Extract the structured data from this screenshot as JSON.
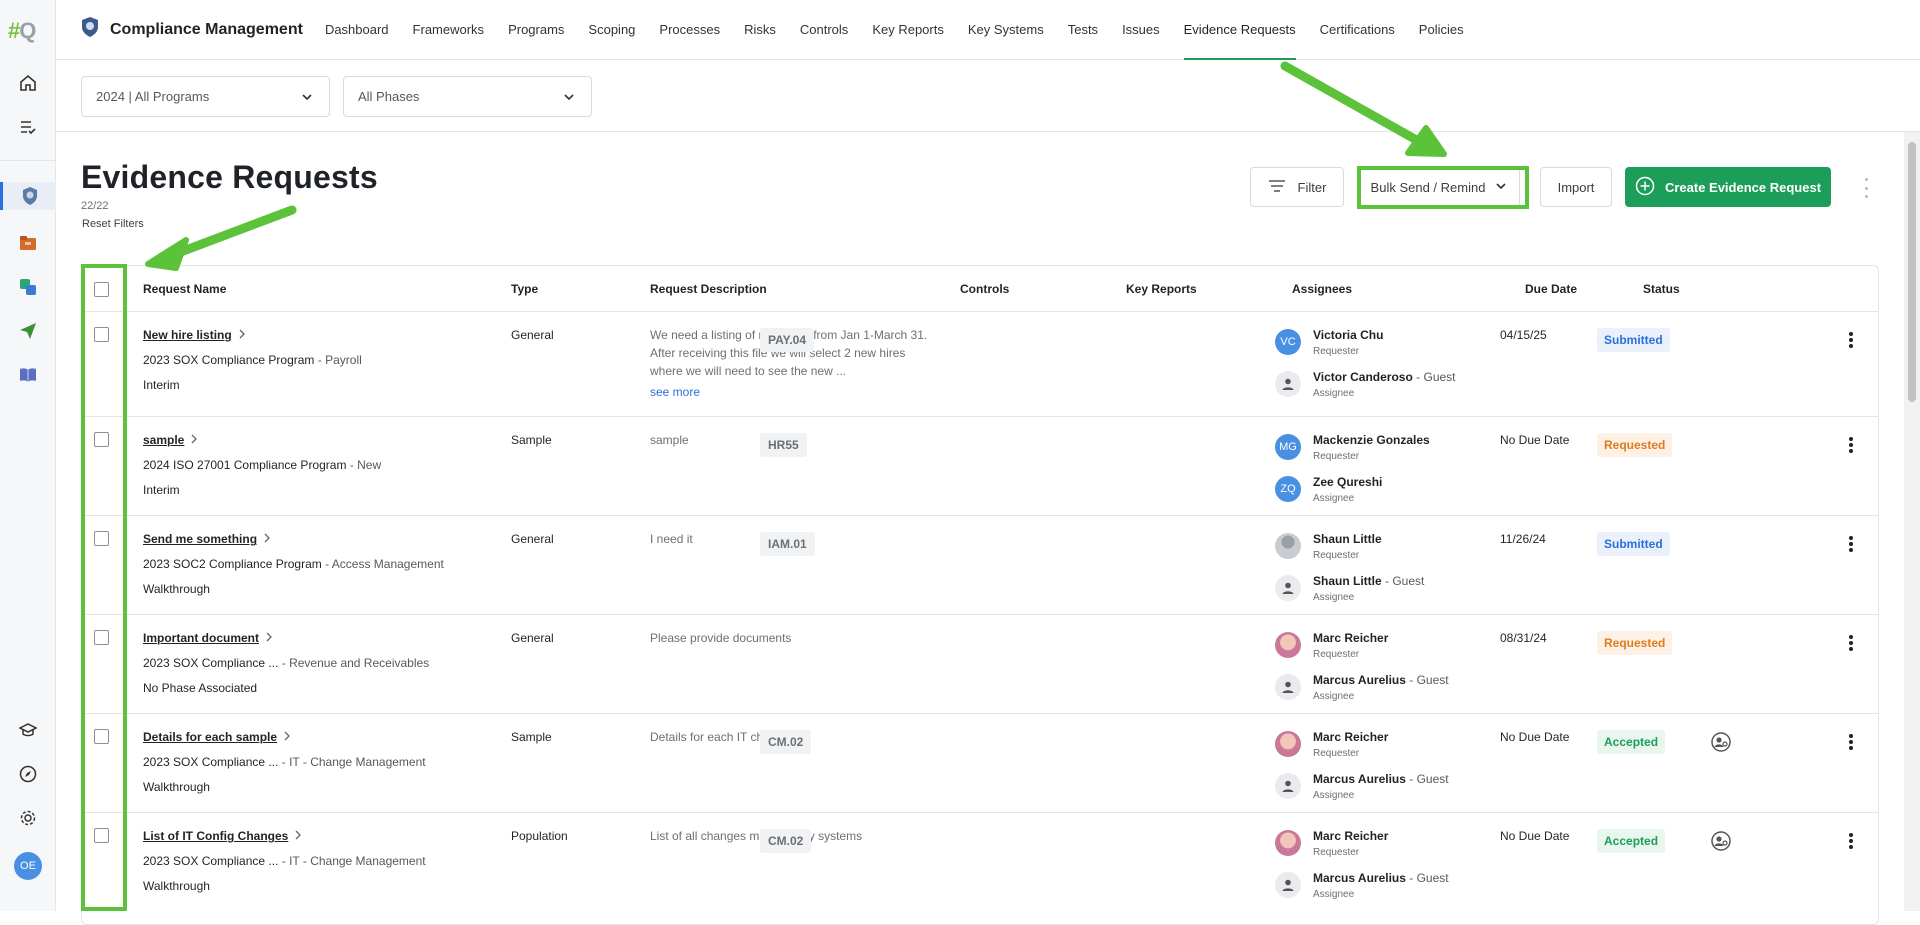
{
  "rail": {
    "logo_main": "#",
    "logo_suffix": "Q",
    "user_initials": "OE"
  },
  "app": {
    "title": "Compliance Management"
  },
  "nav": [
    "Dashboard",
    "Frameworks",
    "Programs",
    "Scoping",
    "Processes",
    "Risks",
    "Controls",
    "Key Reports",
    "Key Systems",
    "Tests",
    "Issues",
    "Evidence Requests",
    "Certifications",
    "Policies"
  ],
  "nav_active": "Evidence Requests",
  "filters": {
    "program": "2024 | All Programs",
    "phase": "All Phases"
  },
  "page": {
    "title": "Evidence Requests",
    "count": "22/22",
    "reset": "Reset Filters"
  },
  "actions": {
    "filter": "Filter",
    "bulk": "Bulk Send / Remind",
    "import": "Import",
    "create": "Create Evidence Request"
  },
  "columns": [
    "Request Name",
    "Type",
    "Request Description",
    "Controls",
    "Key Reports",
    "Assignees",
    "Due Date",
    "Status"
  ],
  "rows": [
    {
      "name": "New hire listing",
      "program": "2023 SOX Compliance Program",
      "process": "Payroll",
      "phase": "Interim",
      "type": "General",
      "desc": "We need a listing of new hires from Jan 1-March 31. After receiving this file we will select 2 new hires where we will need to see the new ...",
      "more": "see more",
      "control": "PAY.04",
      "req_initials": "VC",
      "requester": "Victoria Chu",
      "requester_role": "Requester",
      "assignee": "Victor Canderoso",
      "assignee_suffix": "Guest",
      "assignee_role": "Assignee",
      "due": "04/15/25",
      "status": "Submitted"
    },
    {
      "name": "sample",
      "program": "2024 ISO 27001 Compliance Program",
      "process": "New",
      "phase": "Interim",
      "type": "Sample",
      "desc": "sample",
      "control": "HR55",
      "req_initials": "MG",
      "requester": "Mackenzie Gonzales",
      "requester_role": "Requester",
      "asg_initials": "ZQ",
      "assignee": "Zee Qureshi",
      "assignee_role": "Assignee",
      "due": "No Due Date",
      "status": "Requested"
    },
    {
      "name": "Send me something",
      "program": "2023 SOC2 Compliance Program",
      "process": "Access Management",
      "phase": "Walkthrough",
      "type": "General",
      "desc": "I need it",
      "control": "IAM.01",
      "requester": "Shaun Little",
      "requester_role": "Requester",
      "assignee": "Shaun Little",
      "assignee_suffix": "Guest",
      "assignee_role": "Assignee",
      "due": "11/26/24",
      "status": "Submitted"
    },
    {
      "name": "Important document",
      "program": "2023 SOX Compliance ...",
      "process": "Revenue and Receivables",
      "phase": "No Phase Associated",
      "type": "General",
      "desc": "Please provide documents",
      "requester": "Marc Reicher",
      "requester_role": "Requester",
      "assignee": "Marcus Aurelius",
      "assignee_suffix": "Guest",
      "assignee_role": "Assignee",
      "due": "08/31/24",
      "status": "Requested"
    },
    {
      "name": "Details for each sample",
      "program": "2023 SOX Compliance ...",
      "process": "IT - Change Management",
      "phase": "Walkthrough",
      "type": "Sample",
      "desc": "Details for each IT change",
      "control": "CM.02",
      "requester": "Marc Reicher",
      "requester_role": "Requester",
      "assignee": "Marcus Aurelius",
      "assignee_suffix": "Guest",
      "assignee_role": "Assignee",
      "due": "No Due Date",
      "status": "Accepted"
    },
    {
      "name": "List of IT Config Changes",
      "program": "2023 SOX Compliance ...",
      "process": "IT - Change Management",
      "phase": "Walkthrough",
      "type": "Population",
      "desc": "List of all changes made to key systems",
      "control": "CM.02",
      "requester": "Marc Reicher",
      "requester_role": "Requester",
      "assignee": "Marcus Aurelius",
      "assignee_suffix": "Guest",
      "assignee_role": "Assignee",
      "due": "No Due Date",
      "status": "Accepted"
    }
  ],
  "sep": " - ",
  "colors": {
    "accent": "#1d9d5a",
    "highlight": "#5cc23a",
    "link": "#2a6fdb"
  }
}
